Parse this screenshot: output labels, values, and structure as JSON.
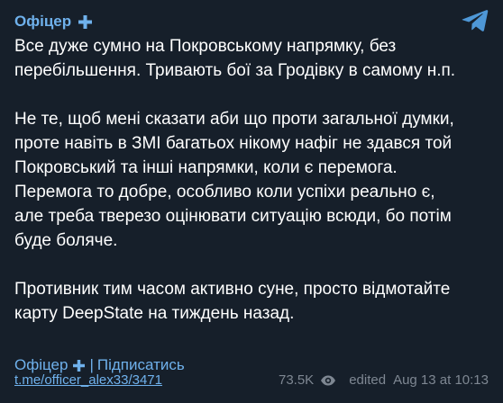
{
  "channel": {
    "name": "Офіцер",
    "accent": "#6fb1ec"
  },
  "message": {
    "paragraphs": [
      [
        "Все дуже сумно на Покровському напрямку, без",
        "перебільшення. Тривають бої за Гродівку в самому н.п."
      ],
      [
        "Не те, щоб мені сказати аби що проти загальної думки,",
        "проте навіть в ЗМІ багатьох нікому нафіг не здався той",
        "Покровський та інші напрямки, коли є перемога.",
        "Перемога то добре, особливо коли успіхи реально є,",
        "але треба тверезо оцінювати ситуацію всюди, бо потім",
        "буде боляче."
      ],
      [
        "Противник тим часом активно суне, просто відмотайте",
        "карту DeepState на тиждень назад."
      ]
    ]
  },
  "signature": {
    "channel_link": "Офіцер",
    "separator": "|",
    "subscribe": "Підписатись"
  },
  "footer": {
    "post_link": "t.me/officer_alex33/3471",
    "views": "73.5K",
    "edited_label": "edited",
    "date": "Aug 13 at 10:13"
  },
  "icons": {
    "plus": "plus-icon",
    "logo": "telegram-logo-icon",
    "views": "eye-icon"
  }
}
